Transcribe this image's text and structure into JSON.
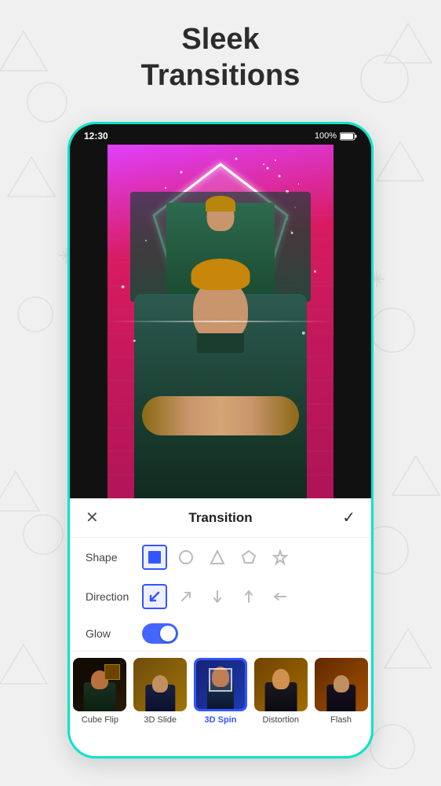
{
  "page": {
    "title_line1": "Sleek",
    "title_line2": "Transitions"
  },
  "status_bar": {
    "time": "12:30",
    "battery": "100%"
  },
  "transition_panel": {
    "title": "Transition",
    "close_icon": "✕",
    "check_icon": "✓",
    "shape_label": "Shape",
    "direction_label": "Direction",
    "glow_label": "Glow"
  },
  "thumbnails": [
    {
      "id": "cube-flip",
      "label": "Cube Flip",
      "selected": false,
      "bg_color": "#3a2a0a"
    },
    {
      "id": "3d-slide",
      "label": "3D Slide",
      "selected": false,
      "bg_color": "#8a6010"
    },
    {
      "id": "3d-spin",
      "label": "3D Spin",
      "selected": true,
      "bg_color": "#2244bb"
    },
    {
      "id": "distortion",
      "label": "Distortion",
      "selected": false,
      "bg_color": "#aa7700"
    },
    {
      "id": "flash",
      "label": "Flash",
      "selected": false,
      "bg_color": "#994400"
    }
  ],
  "controls": {
    "glow_on": true,
    "selected_shape": "square",
    "selected_direction": "bottom-left"
  },
  "colors": {
    "accent": "#00e5cc",
    "selected_blue": "#3355ff"
  }
}
